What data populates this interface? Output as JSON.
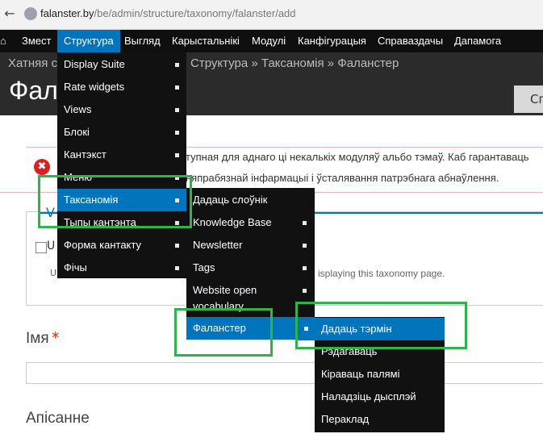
{
  "browser": {
    "url_host": "falanster.by",
    "url_path": "/be/admin/structure/taxonomy/falanster/add"
  },
  "toolbar": {
    "items": [
      "Змест",
      "Структура",
      "Выгляд",
      "Карыстальнікі",
      "Модулі",
      "Канфігурацыя",
      "Справаздачы",
      "Дапамога"
    ]
  },
  "header": {
    "breadcrumb_start": "Хатняя с",
    "breadcrumb_end": "Структура » Таксаномія » Фаланстер",
    "title": "Фала",
    "shortcut_button": "Сп"
  },
  "message": {
    "text": "тупная для аднаго ці некалькіх модуляў альбо тэмаў. Каб гарантаваць няпрабязнай інфармацыі і ўсталявання патрэбнага абнаўлення."
  },
  "fieldset": {
    "legend_initial": "V",
    "checkbox_initial": "U",
    "description_start": "U",
    "description_end": "isplaying this taxonomy page."
  },
  "form": {
    "name_label": "Імя",
    "required_mark": "*",
    "description_label": "Апісанне"
  },
  "menu_structure": {
    "items": [
      "Display Suite",
      "Rate widgets",
      "Views",
      "Блокі",
      "Кантэкст",
      "Меню",
      "Таксаномія",
      "Тыпы кантэнта",
      "Форма кантакту",
      "Фічы"
    ]
  },
  "menu_taxonomy": {
    "items": [
      "Дадаць слоўнік",
      "Knowledge Base",
      "Newsletter",
      "Tags",
      "Website open vocabulary",
      "Фаланстер"
    ]
  },
  "menu_falanster": {
    "items": [
      "Дадаць тэрмін",
      "Рэдагаваць",
      "Кіраваць палямі",
      "Наладзіць дысплэй",
      "Пераклад"
    ]
  },
  "colors": {
    "toolbar_bg": "#0f0f0f",
    "menu_active": "#0074bd",
    "highlight": "#2fb34a",
    "error": "#d72222"
  }
}
